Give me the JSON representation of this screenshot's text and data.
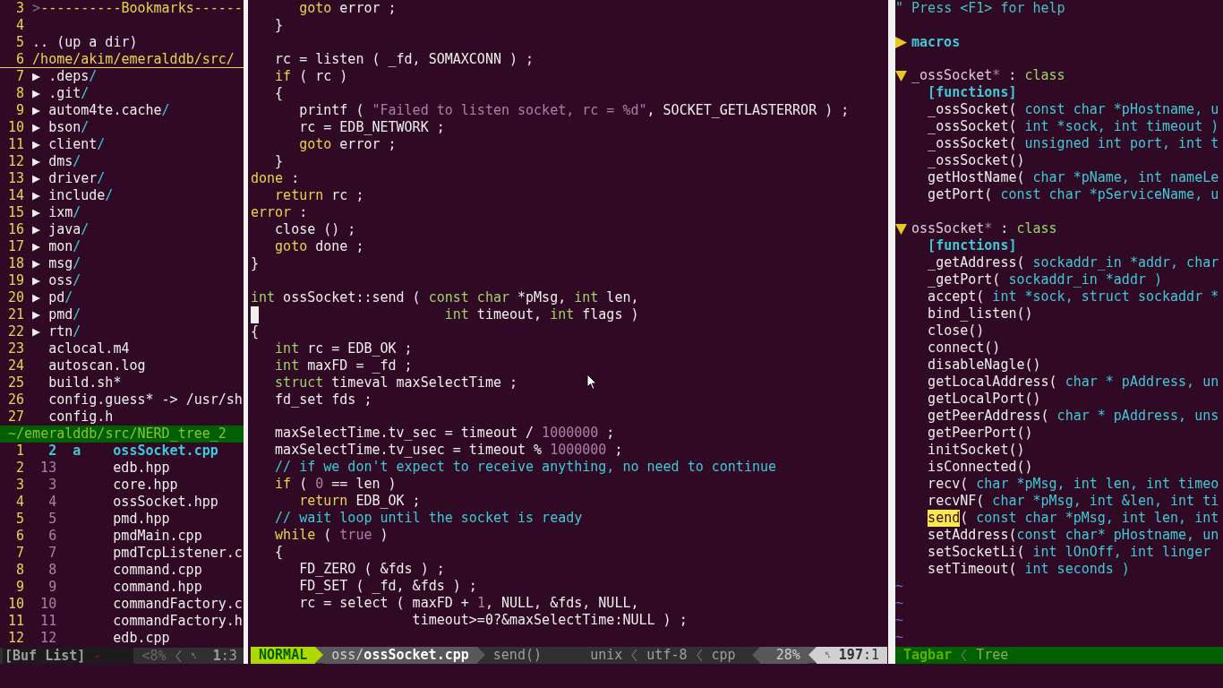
{
  "tree": {
    "rows": [
      {
        "kind": "header",
        "number": "3",
        "marker": ">",
        "text": "----------Bookmarks------"
      },
      {
        "kind": "blank",
        "number": "4"
      },
      {
        "kind": "updir",
        "number": "5",
        "text": ".. (up a dir)"
      },
      {
        "kind": "cwd",
        "number": "6",
        "text": "/home/akim/emeralddb/src/",
        "cursorline": true
      },
      {
        "kind": "dir",
        "number": "7",
        "arrow": "▶",
        "name": ".deps",
        "slash": "/"
      },
      {
        "kind": "dir",
        "number": "8",
        "arrow": "▶",
        "name": ".git",
        "slash": "/"
      },
      {
        "kind": "dir",
        "number": "9",
        "arrow": "▶",
        "name": "autom4te.cache",
        "slash": "/"
      },
      {
        "kind": "dir",
        "number": "10",
        "arrow": "▶",
        "name": "bson",
        "slash": "/"
      },
      {
        "kind": "dir",
        "number": "11",
        "arrow": "▶",
        "name": "client",
        "slash": "/"
      },
      {
        "kind": "dir",
        "number": "12",
        "arrow": "▶",
        "name": "dms",
        "slash": "/"
      },
      {
        "kind": "dir",
        "number": "13",
        "arrow": "▶",
        "name": "driver",
        "slash": "/"
      },
      {
        "kind": "dir",
        "number": "14",
        "arrow": "▶",
        "name": "include",
        "slash": "/"
      },
      {
        "kind": "dir",
        "number": "15",
        "arrow": "▶",
        "name": "ixm",
        "slash": "/"
      },
      {
        "kind": "dir",
        "number": "16",
        "arrow": "▶",
        "name": "java",
        "slash": "/"
      },
      {
        "kind": "dir",
        "number": "17",
        "arrow": "▶",
        "name": "mon",
        "slash": "/"
      },
      {
        "kind": "dir",
        "number": "18",
        "arrow": "▶",
        "name": "msg",
        "slash": "/"
      },
      {
        "kind": "dir",
        "number": "19",
        "arrow": "▶",
        "name": "oss",
        "slash": "/"
      },
      {
        "kind": "dir",
        "number": "20",
        "arrow": "▶",
        "name": "pd",
        "slash": "/"
      },
      {
        "kind": "dir",
        "number": "21",
        "arrow": "▶",
        "name": "pmd",
        "slash": "/"
      },
      {
        "kind": "dir",
        "number": "22",
        "arrow": "▶",
        "name": "rtn",
        "slash": "/"
      },
      {
        "kind": "file",
        "number": "23",
        "name": "aclocal.m4"
      },
      {
        "kind": "file",
        "number": "24",
        "name": "autoscan.log"
      },
      {
        "kind": "file",
        "number": "25",
        "name": "build.sh*"
      },
      {
        "kind": "file",
        "number": "26",
        "name": "config.guess* -> /usr/sh"
      },
      {
        "kind": "file",
        "number": "27",
        "name": "config.h"
      }
    ],
    "status": "~/emeralddb/src/NERD_tree_2"
  },
  "buffers": {
    "rows": [
      {
        "number": "1",
        "buffer": "2",
        "flag": "a",
        "name": "ossSocket.cpp",
        "current": true
      },
      {
        "number": "2",
        "buffer": "13",
        "name": "edb.hpp",
        "current": false
      },
      {
        "number": "3",
        "buffer": "3",
        "name": "core.hpp",
        "current": false
      },
      {
        "number": "4",
        "buffer": "4",
        "name": "ossSocket.hpp",
        "current": false
      },
      {
        "number": "5",
        "buffer": "5",
        "name": "pmd.hpp",
        "current": false
      },
      {
        "number": "6",
        "buffer": "6",
        "name": "pmdMain.cpp",
        "current": false
      },
      {
        "number": "7",
        "buffer": "7",
        "name": "pmdTcpListener.c",
        "current": false
      },
      {
        "number": "8",
        "buffer": "8",
        "name": "command.cpp",
        "current": false
      },
      {
        "number": "9",
        "buffer": "9",
        "name": "command.hpp",
        "current": false
      },
      {
        "number": "10",
        "buffer": "10",
        "name": "commandFactory.c",
        "current": false
      },
      {
        "number": "11",
        "buffer": "11",
        "name": "commandFactory.h",
        "current": false
      },
      {
        "number": "12",
        "buffer": "12",
        "name": "edb.cpp",
        "current": false
      }
    ],
    "status": {
      "name": "[Buf List]",
      "modified": "-",
      "percent": "<8%",
      "ln_symbol": "␤",
      "position": "**1**:3"
    }
  },
  "editor": {
    "lines": [
      {
        "kind": "code",
        "segments": [
          {
            "kind": "keyword",
            "text": "      goto"
          },
          {
            "kind": "plain",
            "text": " error ;"
          }
        ]
      },
      {
        "kind": "code",
        "segments": [
          {
            "kind": "plain",
            "text": "   }"
          }
        ]
      },
      {
        "kind": "blank"
      },
      {
        "kind": "code",
        "segments": [
          {
            "kind": "plain",
            "text": "   rc = listen ( _fd, SOMAXCONN ) ;"
          }
        ]
      },
      {
        "kind": "code",
        "segments": [
          {
            "kind": "keyword",
            "text": "   if"
          },
          {
            "kind": "plain",
            "text": " ( rc )"
          }
        ]
      },
      {
        "kind": "code",
        "segments": [
          {
            "kind": "plain",
            "text": "   {"
          }
        ]
      },
      {
        "kind": "code",
        "segments": [
          {
            "kind": "plain",
            "text": "      printf ( "
          },
          {
            "kind": "string",
            "text": "\"Failed to listen socket, rc = %d\""
          },
          {
            "kind": "plain",
            "text": ", SOCKET_GETLASTERROR ) ;"
          }
        ]
      },
      {
        "kind": "code",
        "segments": [
          {
            "kind": "plain",
            "text": "      rc = EDB_NETWORK ;"
          }
        ]
      },
      {
        "kind": "code",
        "segments": [
          {
            "kind": "keyword",
            "text": "      goto"
          },
          {
            "kind": "plain",
            "text": " error ;"
          }
        ]
      },
      {
        "kind": "code",
        "segments": [
          {
            "kind": "plain",
            "text": "   }"
          }
        ]
      },
      {
        "kind": "code",
        "segments": [
          {
            "kind": "keyword",
            "text": "done"
          },
          {
            "kind": "plain",
            "text": " :"
          }
        ]
      },
      {
        "kind": "code",
        "segments": [
          {
            "kind": "keyword",
            "text": "   return"
          },
          {
            "kind": "plain",
            "text": " rc ;"
          }
        ]
      },
      {
        "kind": "code",
        "segments": [
          {
            "kind": "keyword",
            "text": "error"
          },
          {
            "kind": "plain",
            "text": " :"
          }
        ]
      },
      {
        "kind": "code",
        "segments": [
          {
            "kind": "plain",
            "text": "   close () ;"
          }
        ]
      },
      {
        "kind": "code",
        "segments": [
          {
            "kind": "keyword",
            "text": "   goto"
          },
          {
            "kind": "plain",
            "text": " done ;"
          }
        ]
      },
      {
        "kind": "code",
        "segments": [
          {
            "kind": "plain",
            "text": "}"
          }
        ]
      },
      {
        "kind": "blank"
      },
      {
        "kind": "code",
        "segments": [
          {
            "kind": "type",
            "text": "int"
          },
          {
            "kind": "plain",
            "text": " ossSocket::send ( "
          },
          {
            "kind": "type",
            "text": "const char"
          },
          {
            "kind": "plain",
            "text": " *pMsg, "
          },
          {
            "kind": "type",
            "text": "int"
          },
          {
            "kind": "plain",
            "text": " len,"
          }
        ]
      },
      {
        "kind": "code",
        "cursor": true,
        "segments": [
          {
            "kind": "type",
            "text": "                       int"
          },
          {
            "kind": "plain",
            "text": " timeout, "
          },
          {
            "kind": "type",
            "text": "int"
          },
          {
            "kind": "plain",
            "text": " flags )"
          }
        ]
      },
      {
        "kind": "code",
        "segments": [
          {
            "kind": "plain",
            "text": "{"
          }
        ]
      },
      {
        "kind": "code",
        "segments": [
          {
            "kind": "type",
            "text": "   int"
          },
          {
            "kind": "plain",
            "text": " rc = EDB_OK ;"
          }
        ]
      },
      {
        "kind": "code",
        "segments": [
          {
            "kind": "type",
            "text": "   int"
          },
          {
            "kind": "plain",
            "text": " maxFD = _fd ;"
          }
        ]
      },
      {
        "kind": "code",
        "segments": [
          {
            "kind": "type",
            "text": "   struct"
          },
          {
            "kind": "plain",
            "text": " timeval maxSelectTime ;"
          }
        ]
      },
      {
        "kind": "code",
        "segments": [
          {
            "kind": "plain",
            "text": "   fd_set fds ;"
          }
        ]
      },
      {
        "kind": "blank"
      },
      {
        "kind": "code",
        "segments": [
          {
            "kind": "plain",
            "text": "   maxSelectTime.tv_sec = timeout / "
          },
          {
            "kind": "number",
            "text": "1000000"
          },
          {
            "kind": "plain",
            "text": " ;"
          }
        ]
      },
      {
        "kind": "code",
        "segments": [
          {
            "kind": "plain",
            "text": "   maxSelectTime.tv_usec = timeout % "
          },
          {
            "kind": "number",
            "text": "1000000"
          },
          {
            "kind": "plain",
            "text": " ;"
          }
        ]
      },
      {
        "kind": "code",
        "segments": [
          {
            "kind": "comment",
            "text": "   // if we don't expect to receive anything, no need to continue"
          }
        ]
      },
      {
        "kind": "code",
        "segments": [
          {
            "kind": "keyword",
            "text": "   if"
          },
          {
            "kind": "plain",
            "text": " ( "
          },
          {
            "kind": "number",
            "text": "0"
          },
          {
            "kind": "plain",
            "text": " == len )"
          }
        ]
      },
      {
        "kind": "code",
        "segments": [
          {
            "kind": "keyword",
            "text": "      return"
          },
          {
            "kind": "plain",
            "text": " EDB_OK ;"
          }
        ]
      },
      {
        "kind": "code",
        "segments": [
          {
            "kind": "comment",
            "text": "   // wait loop until the socket is ready"
          }
        ]
      },
      {
        "kind": "code",
        "segments": [
          {
            "kind": "keyword",
            "text": "   while"
          },
          {
            "kind": "plain",
            "text": " ( "
          },
          {
            "kind": "number",
            "text": "true"
          },
          {
            "kind": "plain",
            "text": " )"
          }
        ]
      },
      {
        "kind": "code",
        "segments": [
          {
            "kind": "plain",
            "text": "   {"
          }
        ]
      },
      {
        "kind": "code",
        "segments": [
          {
            "kind": "plain",
            "text": "      FD_ZERO ( &fds ) ;"
          }
        ]
      },
      {
        "kind": "code",
        "segments": [
          {
            "kind": "plain",
            "text": "      FD_SET ( _fd, &fds ) ;"
          }
        ]
      },
      {
        "kind": "code",
        "segments": [
          {
            "kind": "plain",
            "text": "      rc = select ( maxFD + "
          },
          {
            "kind": "number",
            "text": "1"
          },
          {
            "kind": "plain",
            "text": ", NULL, &fds, NULL,"
          }
        ]
      },
      {
        "kind": "code",
        "segments": [
          {
            "kind": "plain",
            "text": "                    timeout>=0?&maxSelectTime:NULL ) ;"
          }
        ]
      },
      {
        "kind": "blank"
      }
    ],
    "status": {
      "mode": "NORMAL",
      "file": "oss/**ossSocket.cpp**",
      "function": "send()",
      "fileformat": "unix",
      "encoding": "utf-8",
      "filetype": "cpp",
      "percent": "28%",
      "ln_symbol": "␤",
      "position": "**197**:1"
    }
  },
  "tagbar": {
    "help": "\" Press <F1> for help",
    "sections": [
      {
        "kind": "group",
        "expanded": false,
        "name": "macros"
      },
      {
        "kind": "class",
        "expanded": true,
        "name": "_ossSocket",
        "star": "*",
        "separator": " : ",
        "type": "class",
        "group": "[functions]",
        "children": [
          {
            "name": "_ossSocket",
            "paren": "(",
            "params": " const char *pHostname, u",
            "highlighted": false
          },
          {
            "name": "_ossSocket",
            "paren": "(",
            "params": " int *sock, int timeout )",
            "highlighted": false
          },
          {
            "name": "_ossSocket",
            "paren": "(",
            "params": " unsigned int port, int t",
            "highlighted": false
          },
          {
            "name": "_ossSocket()",
            "highlighted": false
          },
          {
            "name": "getHostName",
            "paren": "(",
            "params": " char *pName, int nameLe",
            "highlighted": false
          },
          {
            "name": "getPort",
            "paren": "(",
            "params": " const char *pServiceName, u",
            "highlighted": false
          }
        ]
      },
      {
        "kind": "class",
        "expanded": true,
        "name": "ossSocket",
        "star": "*",
        "separator": " : ",
        "type": "class",
        "group": "[functions]",
        "children": [
          {
            "name": "_getAddress",
            "paren": "(",
            "params": " sockaddr_in *addr, char",
            "highlighted": false
          },
          {
            "name": "_getPort",
            "paren": "(",
            "params": " sockaddr_in *addr )",
            "highlighted": false
          },
          {
            "name": "accept",
            "paren": "(",
            "params": " int *sock, struct sockaddr *",
            "highlighted": false
          },
          {
            "name": "bind_listen()",
            "highlighted": false
          },
          {
            "name": "close()",
            "highlighted": false
          },
          {
            "name": "connect()",
            "highlighted": false
          },
          {
            "name": "disableNagle()",
            "highlighted": false
          },
          {
            "name": "getLocalAddress",
            "paren": "(",
            "params": " char * pAddress, un",
            "highlighted": false
          },
          {
            "name": "getLocalPort()",
            "highlighted": false
          },
          {
            "name": "getPeerAddress",
            "paren": "(",
            "params": " char * pAddress, uns",
            "highlighted": false
          },
          {
            "name": "getPeerPort()",
            "highlighted": false
          },
          {
            "name": "initSocket()",
            "highlighted": false
          },
          {
            "name": "isConnected()",
            "highlighted": false
          },
          {
            "name": "recv",
            "paren": "(",
            "params": " char *pMsg, int len, int timeo",
            "highlighted": false
          },
          {
            "name": "recvNF",
            "paren": "(",
            "params": " char *pMsg, int &len, int ti",
            "highlighted": false
          },
          {
            "name": "send",
            "paren": "(",
            "params": " const char *pMsg, int len, int",
            "highlighted": true
          },
          {
            "name": "setAddress",
            "paren": "(",
            "params": "const char* pHostname, un",
            "highlighted": false
          },
          {
            "name": "setSocketLi",
            "paren": "(",
            "params": " int lOnOff, int linger",
            "highlighted": false
          },
          {
            "name": "setTimeout",
            "paren": "(",
            "params": " int seconds )",
            "highlighted": false
          }
        ]
      }
    ],
    "filler": [
      "~",
      "~",
      "~",
      "~"
    ],
    "status": {
      "plugin": "Tagbar",
      "view": "Tree"
    }
  }
}
